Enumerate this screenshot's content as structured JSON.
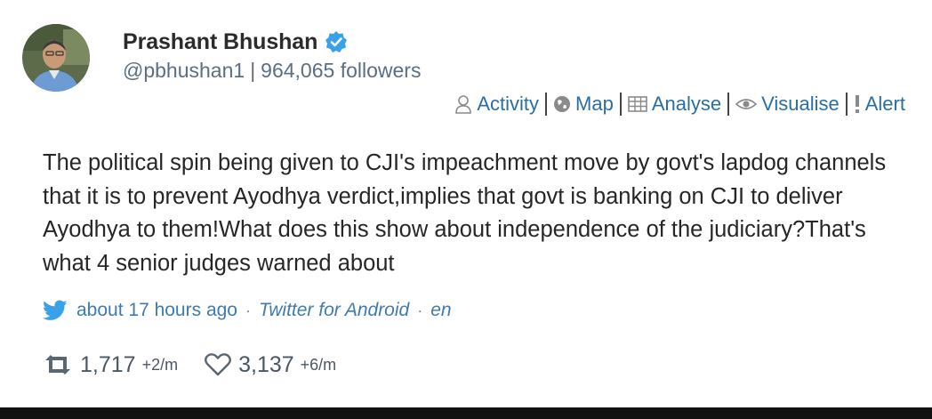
{
  "user": {
    "name": "Prashant Bhushan",
    "handle": "@pbhushan1",
    "separator": "|",
    "followers": "964,065 followers",
    "verified_color": "#3aa0e8"
  },
  "actions": [
    {
      "label": "Activity",
      "icon": "person-icon"
    },
    {
      "label": "Map",
      "icon": "globe-icon"
    },
    {
      "label": "Analyse",
      "icon": "table-icon"
    },
    {
      "label": "Visualise",
      "icon": "eye-icon"
    },
    {
      "label": "Alert",
      "icon": "exclamation-icon"
    }
  ],
  "tweet": {
    "text": "The political spin being given to CJI's impeachment move by govt's lapdog channels that it is to prevent Ayodhya verdict,implies that govt is banking on CJI to deliver Ayodhya to them!What does this show about independence of the judiciary?That's what 4 senior judges warned about"
  },
  "meta": {
    "time": "about 17 hours ago",
    "dot": "·",
    "app": "Twitter for Android",
    "lang": "en"
  },
  "stats": {
    "retweets": {
      "count": "1,717",
      "rate": "+2/m"
    },
    "likes": {
      "count": "3,137",
      "rate": "+6/m"
    }
  },
  "colors": {
    "link": "#2a6ea6",
    "meta": "#3f7bb0",
    "bird": "#3aa0e8"
  }
}
